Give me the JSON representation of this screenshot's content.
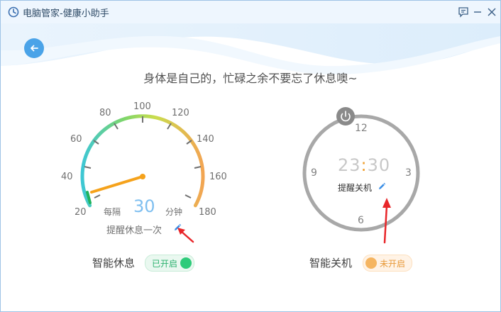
{
  "app": {
    "title": "电脑管家-健康小助手"
  },
  "slogan": "身体是自己的，忙碌之余不要忘了休息噢~",
  "rest": {
    "gauge_ticks": [
      "20",
      "40",
      "60",
      "80",
      "100",
      "120",
      "140",
      "160",
      "180"
    ],
    "interval_prefix": "每隔",
    "interval_value": "30",
    "interval_unit": "分钟",
    "remind_label": "提醒休息一次",
    "feature_label": "智能休息",
    "toggle_label": "已开启",
    "enabled": true
  },
  "shutdown": {
    "clock_numbers": [
      "12",
      "3",
      "6",
      "9"
    ],
    "time_hours": "23",
    "time_sep": ":",
    "time_minutes": "30",
    "shutdown_label": "提醒关机",
    "feature_label": "智能关机",
    "toggle_label": "未开启",
    "enabled": false
  },
  "colors": {
    "accent_blue": "#4aa3e8",
    "on_green": "#2ecb7a",
    "off_orange": "#f5b561",
    "needle": "#f5a21b",
    "arrow_red": "#e8262a"
  },
  "icons": {
    "app": "clock-icon",
    "back": "arrow-left-icon",
    "feedback": "chat-icon",
    "minimize": "minimize-icon",
    "close": "close-icon",
    "power": "power-icon",
    "edit": "pencil-icon"
  }
}
